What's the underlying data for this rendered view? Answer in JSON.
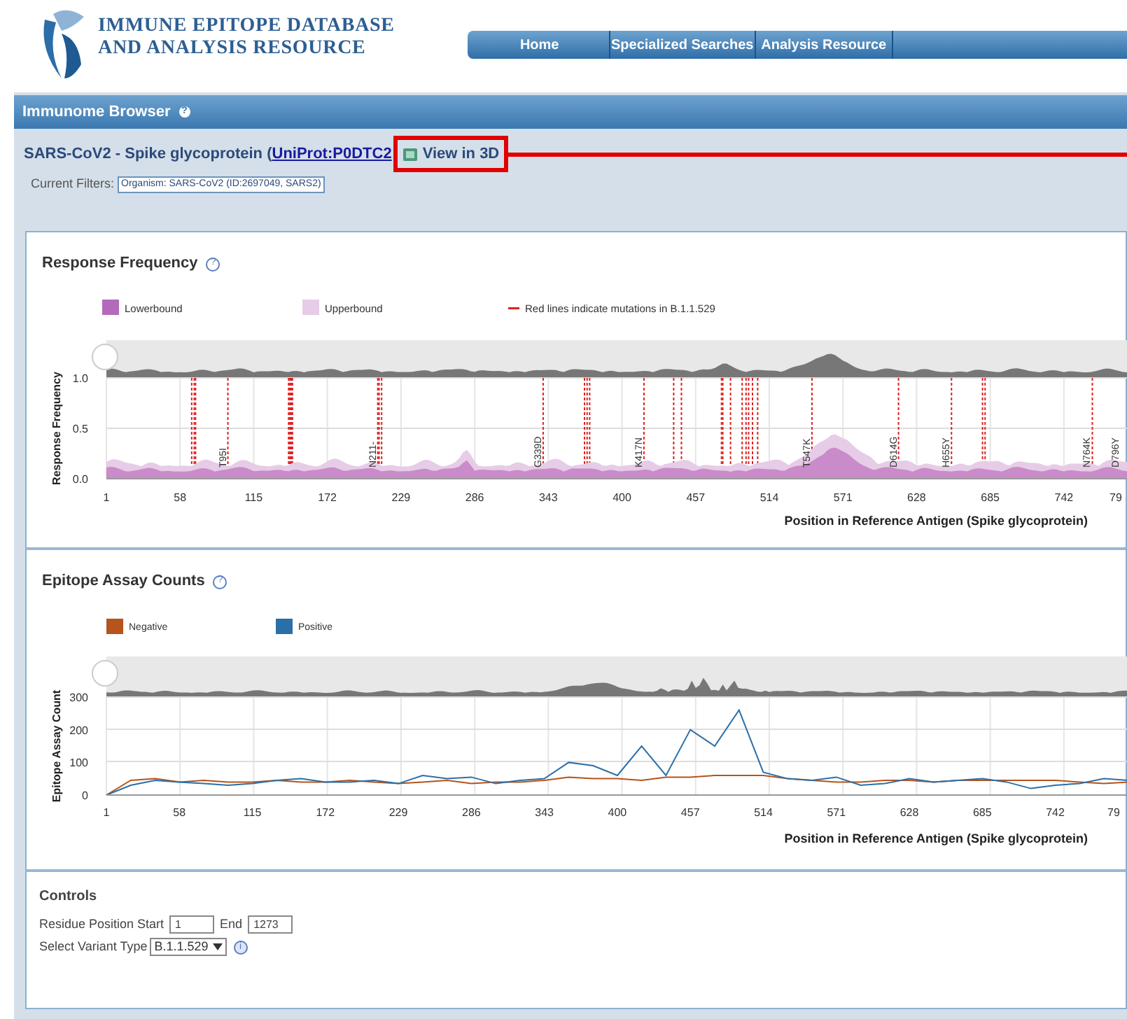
{
  "header": {
    "logo_lines": [
      "IMMUNE EPITOPE DATABASE",
      "AND ANALYSIS RESOURCE"
    ],
    "nav": [
      {
        "label": "Home"
      },
      {
        "label": "Specialized Searches"
      },
      {
        "label": "Analysis Resource"
      }
    ]
  },
  "panel": {
    "title": "Immunome Browser",
    "help": "?",
    "antigen": {
      "name": "SARS-CoV2 - Spike glycoprotein (",
      "link": "UniProt:P0DTC2",
      "view3d": "View in 3D",
      "highlighted": true
    },
    "filters_label": "Current Filters:",
    "filter": "Organism: SARS-CoV2 (ID:2697049, SARS2)"
  },
  "response_frequency": {
    "title": "Response Frequency",
    "help": "?",
    "legend": [
      {
        "label": "Lowerbound",
        "kind": "square",
        "color": "#b46ab8"
      },
      {
        "label": "Upperbound",
        "kind": "square",
        "color": "#e6cce6"
      },
      {
        "label": "Red lines indicate mutations in B.1.1.529",
        "kind": "line",
        "color": "#e02020"
      }
    ],
    "ylabel": "Response Frequency",
    "yticks": [
      "1.0",
      "0.5",
      "0.0"
    ],
    "xticks": [
      "1",
      "58",
      "115",
      "172",
      "229",
      "286",
      "343",
      "400",
      "457",
      "514",
      "571",
      "628",
      "685",
      "742",
      "79"
    ],
    "xlabel": "Position in Reference Antigen (Spike glycoprotein)",
    "mutations": [
      {
        "label": "T95I"
      },
      {
        "label": "N211-"
      },
      {
        "label": "G339D"
      },
      {
        "label": "K417N"
      },
      {
        "label": "T547K"
      },
      {
        "label": "D614G"
      },
      {
        "label": "H655Y"
      },
      {
        "label": "N764K"
      },
      {
        "label": "D796Y"
      }
    ]
  },
  "assay_counts": {
    "title": "Epitope Assay Counts",
    "help": "?",
    "chart_data": {
      "type": "line",
      "xlabel": "Position in Reference Antigen (Spike glycoprotein)",
      "ylabel": "Epitope Assay Count",
      "x": [
        1,
        20,
        39,
        58,
        77,
        96,
        115,
        134,
        153,
        172,
        191,
        210,
        229,
        248,
        267,
        286,
        305,
        324,
        343,
        362,
        381,
        400,
        419,
        438,
        457,
        476,
        495,
        514,
        533,
        552,
        571,
        590,
        609,
        628,
        647,
        666,
        685,
        704,
        723,
        742,
        761,
        780,
        799
      ],
      "series": [
        {
          "name": "Negative",
          "color": "#b5541c",
          "values": [
            0,
            45,
            50,
            40,
            45,
            40,
            40,
            45,
            40,
            40,
            45,
            40,
            35,
            40,
            45,
            35,
            40,
            40,
            45,
            55,
            50,
            50,
            45,
            55,
            55,
            60,
            60,
            60,
            50,
            45,
            40,
            40,
            45,
            45,
            40,
            45,
            45,
            45,
            45,
            45,
            40,
            35,
            40
          ]
        },
        {
          "name": "Positive",
          "color": "#2b6fa8",
          "values": [
            0,
            30,
            45,
            40,
            35,
            30,
            35,
            45,
            50,
            40,
            40,
            45,
            35,
            60,
            50,
            55,
            35,
            45,
            50,
            100,
            90,
            60,
            150,
            60,
            200,
            150,
            260,
            70,
            50,
            45,
            55,
            30,
            35,
            50,
            40,
            45,
            50,
            40,
            20,
            30,
            35,
            50,
            45
          ]
        }
      ],
      "xlim": [
        1,
        810
      ],
      "ylim": [
        0,
        300
      ],
      "grid": true,
      "legend": "top-left",
      "xticks": [
        {
          "value": 1,
          "label": "1"
        },
        {
          "value": 58,
          "label": "58"
        },
        {
          "value": 115,
          "label": "115"
        },
        {
          "value": 172,
          "label": "172"
        },
        {
          "value": 229,
          "label": "229"
        },
        {
          "value": 286,
          "label": "286"
        },
        {
          "value": 343,
          "label": "343"
        },
        {
          "value": 400,
          "label": "400"
        },
        {
          "value": 457,
          "label": "457"
        },
        {
          "value": 514,
          "label": "514"
        },
        {
          "value": 571,
          "label": "571"
        },
        {
          "value": 628,
          "label": "628"
        },
        {
          "value": 685,
          "label": "685"
        },
        {
          "value": 742,
          "label": "742"
        }
      ],
      "yticks": [
        0,
        100,
        200,
        300
      ]
    },
    "cut_tick_label": "79"
  },
  "controls": {
    "title": "Controls",
    "start_label": "Residue Position Start",
    "start": "1",
    "end_label": "End",
    "end": "1273",
    "variant_label": "Select Variant Type",
    "variant": "B.1.1.529",
    "help": "i"
  }
}
